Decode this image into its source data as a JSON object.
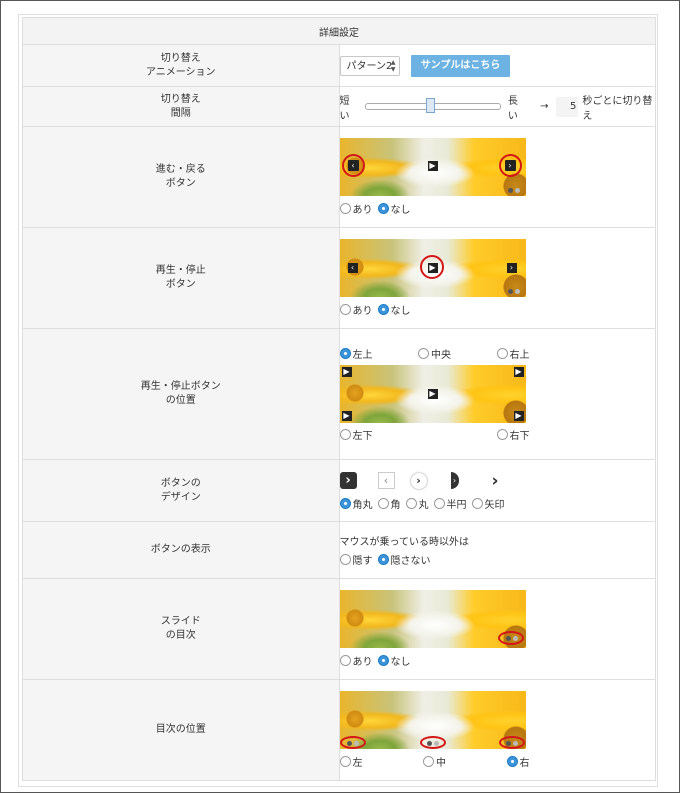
{
  "header": "詳細設定",
  "rows": {
    "switch_anim": {
      "label": "切り替え\nアニメーション",
      "select_value": "パターン2",
      "sample_button": "サンプルはこちら"
    },
    "switch_interval": {
      "label": "切り替え\n間隔",
      "short": "短い",
      "long": "長い",
      "arrow": "→",
      "seconds": "5",
      "suffix": "秒ごとに切り替え",
      "slider_fraction": 0.42
    },
    "nav_buttons": {
      "label": "進む・戻る\nボタン",
      "options": [
        "あり",
        "なし"
      ],
      "selected": "なし"
    },
    "play_stop": {
      "label": "再生・停止\nボタン",
      "options": [
        "あり",
        "なし"
      ],
      "selected": "なし"
    },
    "play_position": {
      "label": "再生・停止ボタン\nの位置",
      "top_options": [
        "左上",
        "中央",
        "右上"
      ],
      "bottom_options": [
        "左下",
        "右下"
      ],
      "selected": "左上"
    },
    "button_design": {
      "label": "ボタンの\nデザイン",
      "options": [
        "角丸",
        "角",
        "丸",
        "半円",
        "矢印"
      ],
      "selected": "角丸"
    },
    "button_display": {
      "label": "ボタンの表示",
      "caption": "マウスが乗っている時以外は",
      "options": [
        "隠す",
        "隠さない"
      ],
      "selected": "隠さない"
    },
    "slide_index": {
      "label": "スライド\nの目次",
      "options": [
        "あり",
        "なし"
      ],
      "selected": "なし"
    },
    "index_position": {
      "label": "目次の位置",
      "options": [
        "左",
        "中",
        "右"
      ],
      "selected": "右"
    }
  },
  "colors": {
    "accent": "#3d95d8",
    "sample_button": "#6cb3e3",
    "highlight_circle": "#d41616"
  }
}
